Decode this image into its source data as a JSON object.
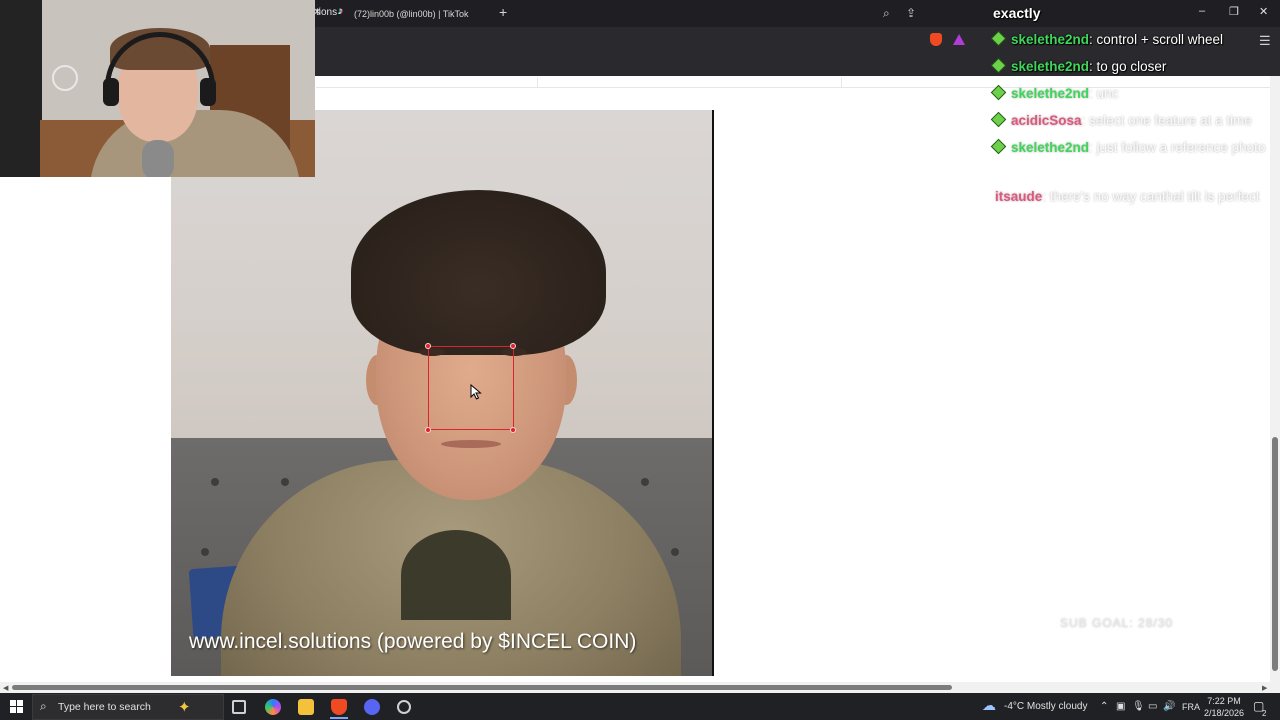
{
  "browser": {
    "tab_title": "(72)lin00b (@lin00b) | TikTok",
    "url_fragment": "tions",
    "new_tab_symbol": "+",
    "window_controls": [
      "–",
      "❐",
      "✕"
    ]
  },
  "video": {
    "watermark": "www.incel.solutions (powered by $INCEL COIN)"
  },
  "chat": {
    "title": "exactly",
    "messages": [
      {
        "user": "skelethe2nd",
        "text": ": control + scroll wheel",
        "user_color": "#3fd65a",
        "badge": true,
        "faded": false
      },
      {
        "user": "skelethe2nd",
        "text": ": to go closer",
        "user_color": "#3fd65a",
        "badge": true,
        "faded": false
      },
      {
        "user": "skelethe2nd",
        "text": ": unc",
        "user_color": "#3fd65a",
        "badge": true,
        "faded": true
      },
      {
        "user": "acidicSosa",
        "text": ": select one feature at a time",
        "user_color": "#e0577e",
        "badge": true,
        "faded": true
      },
      {
        "user": "skelethe2nd",
        "text": ": just follow a reference photo",
        "user_color": "#3fd65a",
        "badge": true,
        "faded": true
      },
      {
        "user": "itsaude",
        "text": ": there's no way canthal tilt is perfect",
        "user_color": "#e0577e",
        "badge": false,
        "faded": true
      }
    ],
    "sub_goal": "SUB GOAL: 28/30"
  },
  "taskbar": {
    "search_placeholder": "Type here to search",
    "weather": "-4°C  Mostly cloudy",
    "language": "FRA",
    "time": "7:22 PM",
    "date": "2/18/2026",
    "notification_count": "2"
  }
}
